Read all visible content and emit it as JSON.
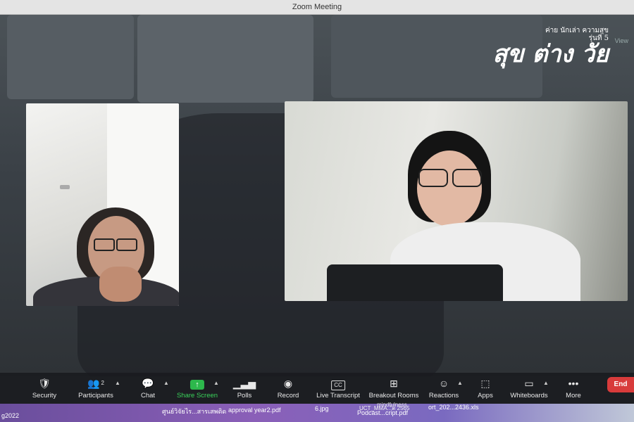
{
  "window": {
    "title": "Zoom Meeting"
  },
  "logo": {
    "text_main": "สุข ต่าง วัย",
    "text_side": "ค่าย นักเล่า ความสุข",
    "text_gen": "รุ่นที่ 5"
  },
  "view_label": "View",
  "toolbar": {
    "security": "Security",
    "participants": "Participants",
    "participants_count": "2",
    "chat": "Chat",
    "share_screen": "Share Screen",
    "polls": "Polls",
    "record": "Record",
    "live_transcript": "Live Transcript",
    "live_transcript_icon": "CC",
    "breakout_rooms": "Breakout Rooms",
    "reactions": "Reactions",
    "apps": "Apps",
    "whiteboards": "Whiteboards",
    "more": "More",
    "end": "End"
  },
  "downloads": {
    "item0": "g2022",
    "item1": "ศูนย์วิจัยไร...สารเสพติด",
    "item2": "approval year2.pdf",
    "item3": "6.jpg",
    "item4_top": "UCT_MMA...ัต 2565",
    "item4": "Podcast...cript.pdf",
    "item4_mid": "mindfulness",
    "item5": "ort_202...2436.xls"
  },
  "colors": {
    "share_green": "#39d35a",
    "end_red": "#d83b3b",
    "toolbar_bg": "#191b1f"
  }
}
